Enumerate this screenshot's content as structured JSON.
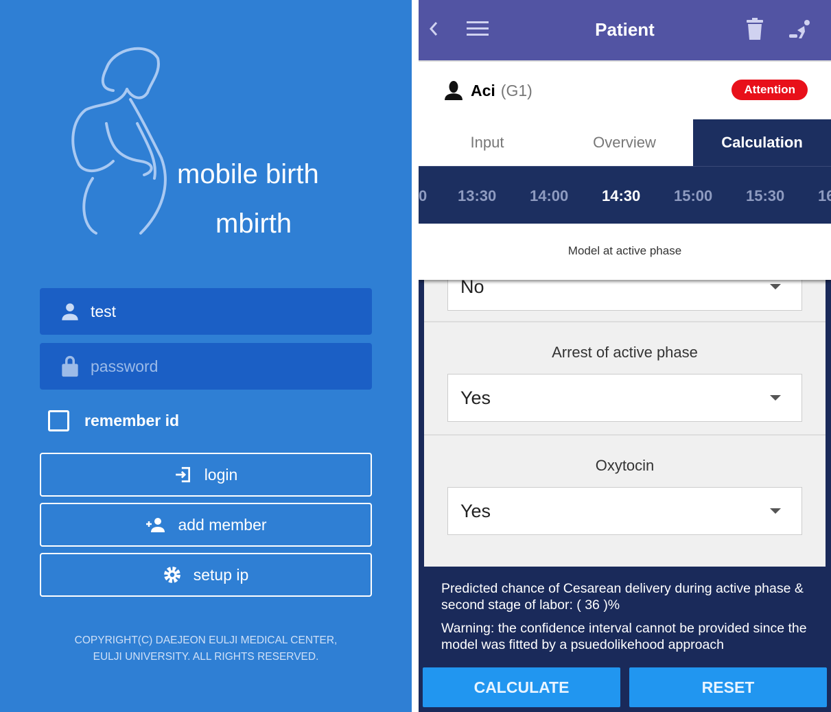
{
  "login": {
    "brand_line1": "mobile birth",
    "brand_line2": "mbirth",
    "username_value": "test",
    "password_placeholder": "password",
    "remember_label": "remember id",
    "remember_checked": false,
    "login_label": "login",
    "add_member_label": "add member",
    "setup_ip_label": "setup ip",
    "copyright_line1": "COPYRIGHT(C) DAEJEON EULJI MEDICAL CENTER,",
    "copyright_line2": "EULJI UNIVERSITY. ALL RIGHTS RESERVED."
  },
  "patient": {
    "header_title": "Patient",
    "name": "Aci",
    "gravida": "(G1)",
    "badge": "Attention",
    "tabs": [
      {
        "label": "Input"
      },
      {
        "label": "Overview"
      },
      {
        "label": "Calculation",
        "active": true
      }
    ],
    "times": [
      "0",
      "13:30",
      "14:00",
      "14:30",
      "15:00",
      "15:30",
      "16"
    ],
    "selected_time": "14:30",
    "model_label": "Model at active phase",
    "fields": [
      {
        "label": "",
        "value": "No"
      },
      {
        "label": "Arrest of active phase",
        "value": "Yes"
      },
      {
        "label": "Oxytocin",
        "value": "Yes"
      }
    ],
    "result_text": "Predicted chance of Cesarean delivery during active phase & second stage of labor: ( 36 )%",
    "warning_text": "Warning: the confidence interval cannot be provided since the model was fitted by a psuedolikehood approach",
    "calculate_label": "CALCULATE",
    "reset_label": "RESET"
  },
  "colors": {
    "login_bg": "#2f7fd4",
    "header": "#5254a3",
    "navy": "#1c2f60",
    "attention": "#e8101a",
    "action": "#2196f0"
  }
}
